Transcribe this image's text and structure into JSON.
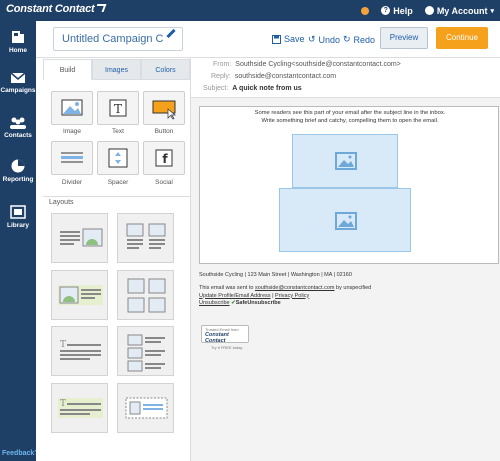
{
  "topbar": {
    "logo": "Constant Contact",
    "help": "Help",
    "account": "My Account",
    "account_caret": "▾"
  },
  "sidenav": {
    "items": [
      {
        "label": "Home"
      },
      {
        "label": "Campaigns"
      },
      {
        "label": "Contacts"
      },
      {
        "label": "Reporting"
      },
      {
        "label": "Library"
      }
    ],
    "feedback": "Feedback?"
  },
  "campaign": {
    "name": "Untitled Campaign C",
    "save": "Save",
    "undo": "Undo",
    "redo": "Redo",
    "preview": "Preview",
    "continue": "Continue"
  },
  "tabs": [
    "Build",
    "Images",
    "Colors"
  ],
  "blocks": [
    "Image",
    "Text",
    "Button",
    "Divider",
    "Spacer",
    "Social"
  ],
  "layouts_label": "Layouts",
  "email_headers": {
    "from_label": "From:",
    "from_value": "Southside Cycling<southside@constantcontact.com>",
    "reply_label": "Reply:",
    "reply_value": "southside@constantcontact.com",
    "subject_label": "Subject:",
    "subject_value": "A quick note from us"
  },
  "preheader": {
    "line1": "Some readers see this part of your email after the subject line in the inbox.",
    "line2": "Write something brief and catchy, compelling them to open the email."
  },
  "footer": {
    "address": "Southside Cycling | 123 Main Street | Washington | MA | 02160",
    "sent_to_prefix": "This email was sent to ",
    "sent_to_email": "southside@constantcontact.com",
    "sent_to_suffix": " by unspecified",
    "update_link": "Update Profile/Email Address",
    "sep": " | ",
    "privacy_link": "Privacy Policy",
    "unsubscribe": "Unsubscribe",
    "safe_unsub": "SafeUnsubscribe",
    "badge_top": "Trusted Email from",
    "badge_brand": "Constant Contact",
    "badge_sub": "Try it FREE today"
  },
  "colors": {
    "nav": "#1e3f66",
    "accent": "#f6a11b",
    "link": "#1f5fa8",
    "placeholder": "#d8eaf8"
  }
}
